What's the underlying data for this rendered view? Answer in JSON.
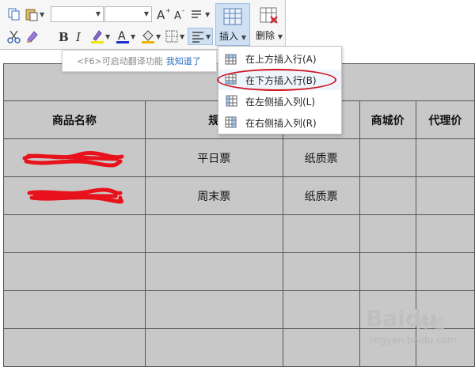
{
  "toolbar": {
    "insert_label": "插入",
    "delete_label": "删除"
  },
  "tooltip": {
    "text": "<F6>可启动翻译功能",
    "link": "我知道了"
  },
  "menu": {
    "items": [
      {
        "label": "在上方插入行(A)",
        "icon": "insert-row-above-icon"
      },
      {
        "label": "在下方插入行(B)",
        "icon": "insert-row-below-icon"
      },
      {
        "label": "在左侧插入列(L)",
        "icon": "insert-column-left-icon"
      },
      {
        "label": "在右侧插入列(R)",
        "icon": "insert-column-right-icon"
      }
    ]
  },
  "table": {
    "headers": [
      "商品名称",
      "规",
      "",
      "商城价",
      "代理价"
    ],
    "rows": [
      [
        "",
        "平日票",
        "纸质票",
        "",
        ""
      ],
      [
        "",
        "周末票",
        "纸质票",
        "",
        ""
      ]
    ]
  },
  "watermark": {
    "logo": "Baidu",
    "sub": "经验",
    "url": "jingyan.baidu.com"
  },
  "colors": {
    "accent": "#d0141f",
    "table_bg": "#c8c8c8",
    "active_button": "#cfe0f3"
  }
}
